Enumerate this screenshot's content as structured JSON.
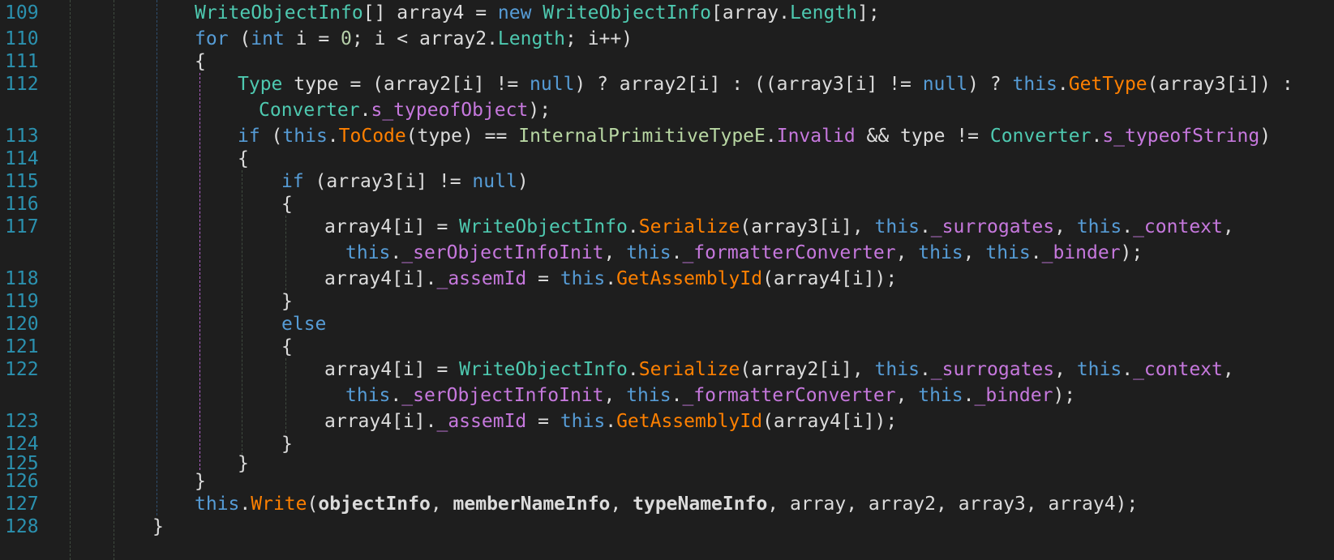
{
  "editor": {
    "lines": [
      {
        "num": "109",
        "indent": 2,
        "tokens": [
          [
            "type",
            "WriteObjectInfo"
          ],
          [
            "plain",
            "[] array4 = "
          ],
          [
            "kw",
            "new"
          ],
          [
            "plain",
            " "
          ],
          [
            "type",
            "WriteObjectInfo"
          ],
          [
            "plain",
            "[array."
          ],
          [
            "type",
            "Length"
          ],
          [
            "plain",
            "];"
          ]
        ]
      },
      {
        "num": "110",
        "indent": 2,
        "tokens": [
          [
            "kw",
            "for"
          ],
          [
            "plain",
            " ("
          ],
          [
            "kw",
            "int"
          ],
          [
            "plain",
            " i = "
          ],
          [
            "num",
            "0"
          ],
          [
            "plain",
            "; i < array2."
          ],
          [
            "type",
            "Length"
          ],
          [
            "plain",
            "; i++)"
          ]
        ]
      },
      {
        "num": "111",
        "indent": 2,
        "tokens": [
          [
            "plain",
            "{"
          ]
        ]
      },
      {
        "num": "112",
        "indent": 3,
        "tokens": [
          [
            "type",
            "Type"
          ],
          [
            "plain",
            " type = (array2[i] != "
          ],
          [
            "kw",
            "null"
          ],
          [
            "plain",
            ") ? array2[i] : ((array3[i] != "
          ],
          [
            "kw",
            "null"
          ],
          [
            "plain",
            ") ? "
          ],
          [
            "kw",
            "this"
          ],
          [
            "plain",
            "."
          ],
          [
            "method",
            "GetType"
          ],
          [
            "plain",
            "(array3[i]) :"
          ]
        ]
      },
      {
        "num": "",
        "indent": 3,
        "cont": true,
        "tokens": [
          [
            "type",
            "Converter"
          ],
          [
            "plain",
            "."
          ],
          [
            "field",
            "s_typeofObject"
          ],
          [
            "plain",
            ");"
          ]
        ]
      },
      {
        "num": "113",
        "indent": 3,
        "tokens": [
          [
            "kw",
            "if"
          ],
          [
            "plain",
            " ("
          ],
          [
            "kw",
            "this"
          ],
          [
            "plain",
            "."
          ],
          [
            "method",
            "ToCode"
          ],
          [
            "plain",
            "(type) == "
          ],
          [
            "enum",
            "InternalPrimitiveTypeE"
          ],
          [
            "plain",
            "."
          ],
          [
            "enumval",
            "Invalid"
          ],
          [
            "plain",
            " && type != "
          ],
          [
            "type",
            "Converter"
          ],
          [
            "plain",
            "."
          ],
          [
            "field",
            "s_typeofString"
          ],
          [
            "plain",
            ")"
          ]
        ]
      },
      {
        "num": "114",
        "indent": 3,
        "tokens": [
          [
            "plain",
            "{"
          ]
        ]
      },
      {
        "num": "115",
        "indent": 4,
        "tokens": [
          [
            "kw",
            "if"
          ],
          [
            "plain",
            " (array3[i] != "
          ],
          [
            "kw",
            "null"
          ],
          [
            "plain",
            ")"
          ]
        ]
      },
      {
        "num": "116",
        "indent": 4,
        "tokens": [
          [
            "plain",
            "{"
          ]
        ]
      },
      {
        "num": "117",
        "indent": 5,
        "tokens": [
          [
            "plain",
            "array4[i] = "
          ],
          [
            "type",
            "WriteObjectInfo"
          ],
          [
            "plain",
            "."
          ],
          [
            "method",
            "Serialize"
          ],
          [
            "plain",
            "(array3[i], "
          ],
          [
            "kw",
            "this"
          ],
          [
            "plain",
            "."
          ],
          [
            "field",
            "_surrogates"
          ],
          [
            "plain",
            ", "
          ],
          [
            "kw",
            "this"
          ],
          [
            "plain",
            "."
          ],
          [
            "field",
            "_context"
          ],
          [
            "plain",
            ","
          ]
        ]
      },
      {
        "num": "",
        "indent": 5,
        "cont": true,
        "tokens": [
          [
            "kw",
            "this"
          ],
          [
            "plain",
            "."
          ],
          [
            "field",
            "_serObjectInfoInit"
          ],
          [
            "plain",
            ", "
          ],
          [
            "kw",
            "this"
          ],
          [
            "plain",
            "."
          ],
          [
            "field",
            "_formatterConverter"
          ],
          [
            "plain",
            ", "
          ],
          [
            "kw",
            "this"
          ],
          [
            "plain",
            ", "
          ],
          [
            "kw",
            "this"
          ],
          [
            "plain",
            "."
          ],
          [
            "field",
            "_binder"
          ],
          [
            "plain",
            ");"
          ]
        ]
      },
      {
        "num": "118",
        "indent": 5,
        "tokens": [
          [
            "plain",
            "array4[i]."
          ],
          [
            "field",
            "_assemId"
          ],
          [
            "plain",
            " = "
          ],
          [
            "kw",
            "this"
          ],
          [
            "plain",
            "."
          ],
          [
            "method",
            "GetAssemblyId"
          ],
          [
            "plain",
            "(array4[i]);"
          ]
        ]
      },
      {
        "num": "119",
        "indent": 4,
        "tokens": [
          [
            "plain",
            "}"
          ]
        ]
      },
      {
        "num": "120",
        "indent": 4,
        "tokens": [
          [
            "kw",
            "else"
          ]
        ]
      },
      {
        "num": "121",
        "indent": 4,
        "tokens": [
          [
            "plain",
            "{"
          ]
        ]
      },
      {
        "num": "122",
        "indent": 5,
        "tokens": [
          [
            "plain",
            "array4[i] = "
          ],
          [
            "type",
            "WriteObjectInfo"
          ],
          [
            "plain",
            "."
          ],
          [
            "method",
            "Serialize"
          ],
          [
            "plain",
            "(array2[i], "
          ],
          [
            "kw",
            "this"
          ],
          [
            "plain",
            "."
          ],
          [
            "field",
            "_surrogates"
          ],
          [
            "plain",
            ", "
          ],
          [
            "kw",
            "this"
          ],
          [
            "plain",
            "."
          ],
          [
            "field",
            "_context"
          ],
          [
            "plain",
            ","
          ]
        ]
      },
      {
        "num": "",
        "indent": 5,
        "cont": true,
        "tokens": [
          [
            "kw",
            "this"
          ],
          [
            "plain",
            "."
          ],
          [
            "field",
            "_serObjectInfoInit"
          ],
          [
            "plain",
            ", "
          ],
          [
            "kw",
            "this"
          ],
          [
            "plain",
            "."
          ],
          [
            "field",
            "_formatterConverter"
          ],
          [
            "plain",
            ", "
          ],
          [
            "kw",
            "this"
          ],
          [
            "plain",
            "."
          ],
          [
            "field",
            "_binder"
          ],
          [
            "plain",
            ");"
          ]
        ]
      },
      {
        "num": "123",
        "indent": 5,
        "tokens": [
          [
            "plain",
            "array4[i]."
          ],
          [
            "field",
            "_assemId"
          ],
          [
            "plain",
            " = "
          ],
          [
            "kw",
            "this"
          ],
          [
            "plain",
            "."
          ],
          [
            "method",
            "GetAssemblyId"
          ],
          [
            "plain",
            "(array4[i]);"
          ]
        ]
      },
      {
        "num": "124",
        "indent": 4,
        "tokens": [
          [
            "plain",
            "}"
          ]
        ]
      },
      {
        "num": "125",
        "indent": 3,
        "tokens": [
          [
            "plain",
            "}"
          ]
        ]
      },
      {
        "num": "126",
        "indent": 2,
        "tokens": [
          [
            "plain",
            "}"
          ]
        ]
      },
      {
        "num": "127",
        "indent": 2,
        "tokens": [
          [
            "kw",
            "this"
          ],
          [
            "plain",
            "."
          ],
          [
            "method",
            "Write"
          ],
          [
            "plain",
            "("
          ],
          [
            "param",
            "objectInfo"
          ],
          [
            "plain",
            ", "
          ],
          [
            "param",
            "memberNameInfo"
          ],
          [
            "plain",
            ", "
          ],
          [
            "param",
            "typeNameInfo"
          ],
          [
            "plain",
            ", array, array2, array3, array4);"
          ]
        ]
      },
      {
        "num": "128",
        "indent": 1,
        "tokens": [
          [
            "plain",
            "}"
          ]
        ]
      }
    ]
  },
  "colors": {
    "background": "#1e1e1e",
    "line_number": "#2b91af",
    "keyword": "#569cd6",
    "type": "#4ec9b0",
    "method": "#ff8000",
    "field": "#c678dd",
    "number": "#b5cea8",
    "plain": "#dcdcdc"
  }
}
